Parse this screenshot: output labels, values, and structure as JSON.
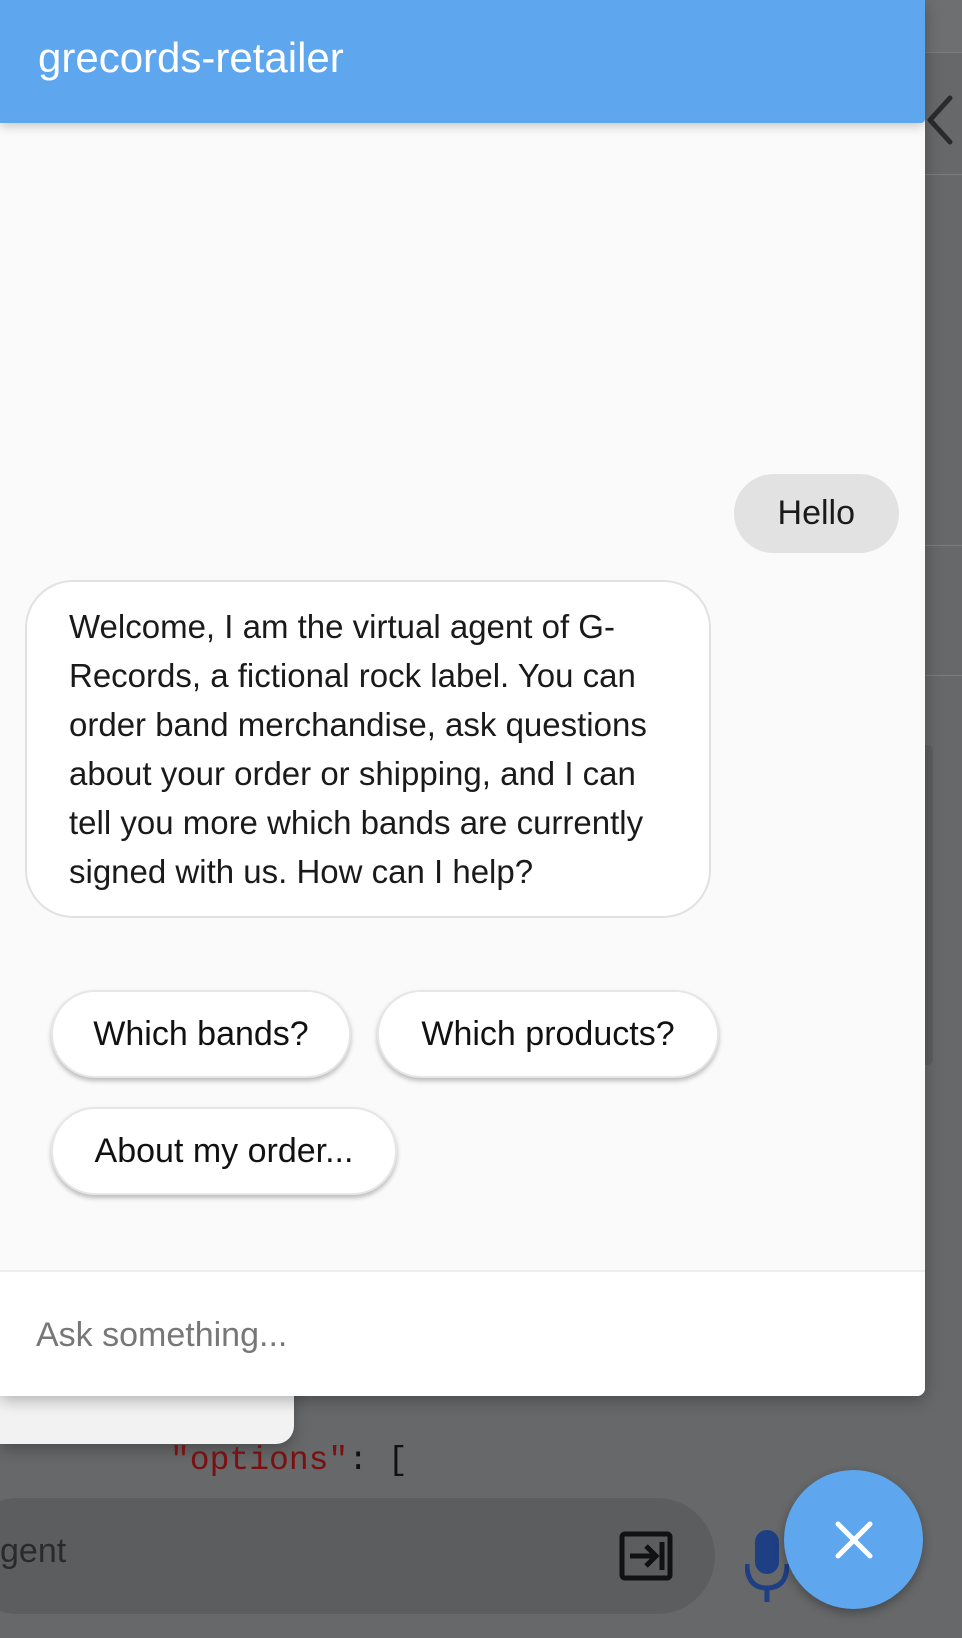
{
  "chat": {
    "title": "grecords-retailer",
    "messages": [
      {
        "from": "user",
        "text": "Hello"
      },
      {
        "from": "bot",
        "text": "Welcome, I am the virtual agent of G-Records, a fictional rock label. You can order band merchandise, ask questions about your order or shipping, and I can tell you more which bands are currently signed with us. How can I help?"
      }
    ],
    "suggestions": [
      "Which bands?",
      "Which products?",
      "About my order..."
    ],
    "input": {
      "placeholder": "Ask something...",
      "value": ""
    }
  },
  "background": {
    "code_key": "\"options\"",
    "code_rest": ": [",
    "input_text_fragment": "gent"
  },
  "colors": {
    "accent": "#5ea7ef",
    "overlay": "#666869",
    "bubble_user": "#e2e2e2",
    "bubble_bot": "#ffffff"
  },
  "icons": {
    "close": "close-icon",
    "back": "chevron-left-icon",
    "enter": "enter-icon",
    "mic": "microphone-icon"
  }
}
